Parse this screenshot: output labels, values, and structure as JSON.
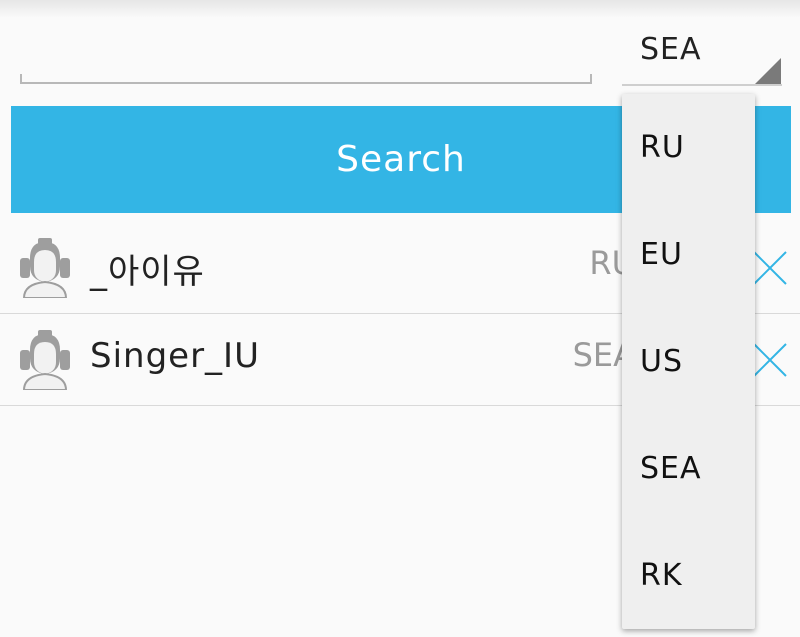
{
  "search": {
    "value": "",
    "button_label": "Search"
  },
  "region_select": {
    "selected": "SEA"
  },
  "results": [
    {
      "name": "_아이유",
      "region": "RU"
    },
    {
      "name": "Singer_IU",
      "region": "SEA"
    }
  ],
  "dropdown": {
    "options": [
      "RU",
      "EU",
      "US",
      "SEA",
      "RK"
    ]
  },
  "colors": {
    "accent": "#33b5e5",
    "remove_icon": "#33b5e5",
    "background": "#fafafa",
    "dropdown_bg": "#efefef"
  },
  "icons": {
    "avatar": "player-avatar-icon",
    "remove": "close-icon",
    "select_corner": "dropdown-corner-icon"
  }
}
